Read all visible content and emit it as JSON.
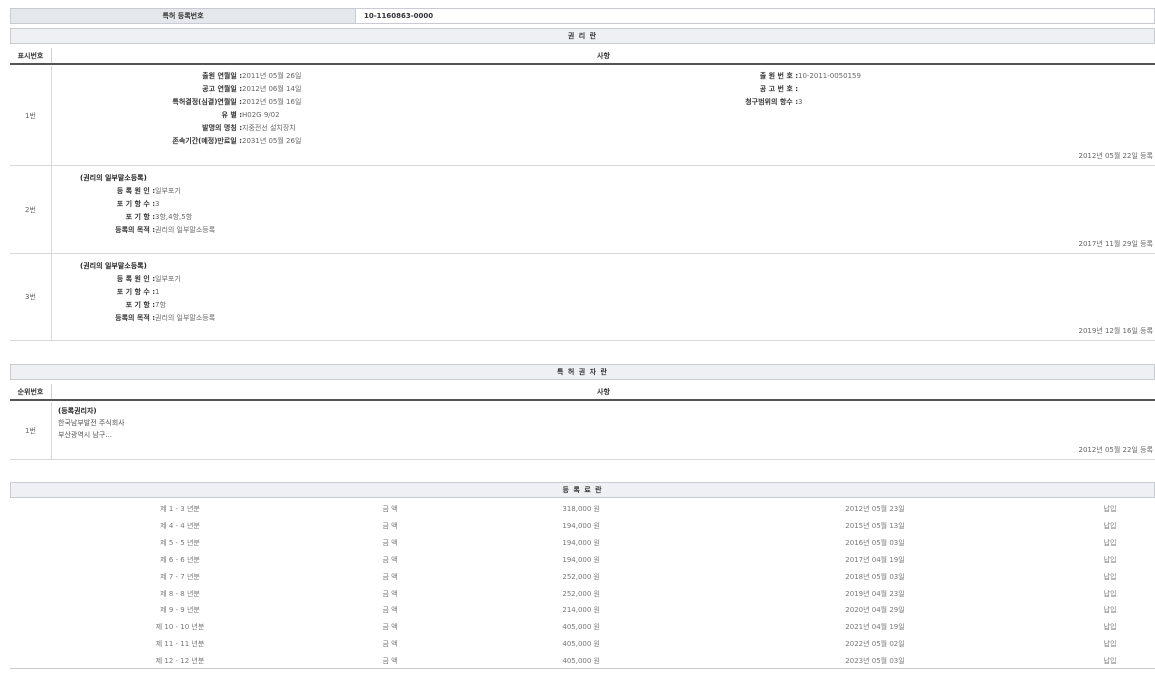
{
  "registration": {
    "label": "특허 등록번호",
    "number": "10-1160863-0000"
  },
  "rights_section": {
    "title": "권 리 란",
    "col_num": "표시번호",
    "col_matter": "사항",
    "entry1": {
      "num": "1번",
      "left": [
        {
          "k": "출원 연월일 : ",
          "v": "2011년 05월 26일"
        },
        {
          "k": "공고 연월일 : ",
          "v": "2012년 06월 14일"
        },
        {
          "k": "특허결정(심결)연월일 : ",
          "v": "2012년 05월 16일"
        },
        {
          "k": "유 별 : ",
          "v": "H02G 9/02"
        },
        {
          "k": "발명의 명칭 : ",
          "v": "지중전선 설치장치"
        },
        {
          "k": "존속기간(예정)만료일 : ",
          "v": "2031년 05월 26일"
        }
      ],
      "right": [
        {
          "k": "출 원 번 호 : ",
          "v": "10-2011-0050159"
        },
        {
          "k": "공 고 번 호 : ",
          "v": ""
        },
        {
          "k": "청구범위의 항수 : ",
          "v": "3"
        }
      ],
      "date": "2012년 05월 22일 등록"
    },
    "entry2": {
      "num": "2번",
      "heading": "(권리의 일부말소등록)",
      "lines": [
        {
          "k": "등 록 원 인 : ",
          "v": "일부포기"
        },
        {
          "k": "포 기 항 수 : ",
          "v": "3"
        },
        {
          "k": "포 기 항 : ",
          "v": "3항,4항,5항"
        },
        {
          "k": "등록의 목적 : ",
          "v": "권리의 일부말소등록"
        }
      ],
      "date": "2017년 11월 29일 등록"
    },
    "entry3": {
      "num": "3번",
      "heading": "(권리의 일부말소등록)",
      "lines": [
        {
          "k": "등 록 원 인 : ",
          "v": "일부포기"
        },
        {
          "k": "포 기 항 수 : ",
          "v": "1"
        },
        {
          "k": "포 기 항 : ",
          "v": "7항"
        },
        {
          "k": "등록의 목적 : ",
          "v": "권리의 일부말소등록"
        }
      ],
      "date": "2019년 12월 16일 등록"
    }
  },
  "owner_section": {
    "title": "특 허 권 자 란",
    "col_num": "순위번호",
    "col_matter": "사항",
    "entry1": {
      "num": "1번",
      "heading": "(등록권리자)",
      "line1": "한국남부발전 주식회사",
      "line2": "부산광역시 남구...",
      "date": "2012년 05월 22일 등록"
    }
  },
  "fee_section": {
    "title": "등 록 료 란",
    "rows": [
      {
        "year": "제 1 - 3 년분",
        "label": "금 액",
        "amount": "318,000 원",
        "date": "2012년 05월 23일",
        "status": "납입"
      },
      {
        "year": "제 4 - 4 년분",
        "label": "금 액",
        "amount": "194,000 원",
        "date": "2015년 05월 13일",
        "status": "납입"
      },
      {
        "year": "제 5 - 5 년분",
        "label": "금 액",
        "amount": "194,000 원",
        "date": "2016년 05월 03일",
        "status": "납입"
      },
      {
        "year": "제 6 - 6 년분",
        "label": "금 액",
        "amount": "194,000 원",
        "date": "2017년 04월 19일",
        "status": "납입"
      },
      {
        "year": "제 7 - 7 년분",
        "label": "금 액",
        "amount": "252,000 원",
        "date": "2018년 05월 03일",
        "status": "납입"
      },
      {
        "year": "제 8 - 8 년분",
        "label": "금 액",
        "amount": "252,000 원",
        "date": "2019년 04월 23일",
        "status": "납입"
      },
      {
        "year": "제 9 - 9 년분",
        "label": "금 액",
        "amount": "214,000 원",
        "date": "2020년 04월 29일",
        "status": "납입"
      },
      {
        "year": "제 10 - 10 년분",
        "label": "금 액",
        "amount": "405,000 원",
        "date": "2021년 04월 19일",
        "status": "납입"
      },
      {
        "year": "제 11 - 11 년분",
        "label": "금 액",
        "amount": "405,000 원",
        "date": "2022년 05월 02일",
        "status": "납입"
      },
      {
        "year": "제 12 - 12 년분",
        "label": "금 액",
        "amount": "405,000 원",
        "date": "2023년 05월 03일",
        "status": "납입"
      }
    ]
  }
}
